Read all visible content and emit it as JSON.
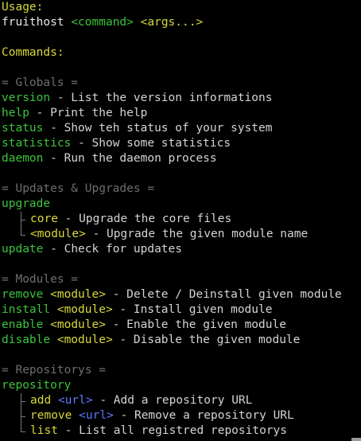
{
  "usage": {
    "label": "Usage:",
    "program": "fruithost",
    "command_arg": "<command>",
    "args_arg": "<args...>"
  },
  "commands_heading": "Commands:",
  "sections": {
    "globals": {
      "title": "= Globals =",
      "items": [
        {
          "cmd": "version",
          "desc": "- List the version informations"
        },
        {
          "cmd": "help",
          "desc": "- Print the help"
        },
        {
          "cmd": "status",
          "desc": "- Show teh status of your system"
        },
        {
          "cmd": "statistics",
          "desc": "- Show some statistics"
        },
        {
          "cmd": "daemon",
          "desc": "- Run the daemon process"
        }
      ]
    },
    "updates": {
      "title": "= Updates & Upgrades =",
      "upgrade": {
        "cmd": "upgrade",
        "subs": [
          {
            "cmd": "core",
            "desc": "- Upgrade the core files"
          },
          {
            "cmd": "<module>",
            "desc": "- Upgrade the given module name"
          }
        ]
      },
      "update": {
        "cmd": "update",
        "desc": "- Check for updates"
      }
    },
    "modules": {
      "title": "= Modules =",
      "items": [
        {
          "cmd": "remove",
          "arg": "<module>",
          "desc": "- Delete / Deinstall given module"
        },
        {
          "cmd": "install",
          "arg": "<module>",
          "desc": "- Install given module"
        },
        {
          "cmd": "enable",
          "arg": "<module>",
          "desc": "- Enable the given module"
        },
        {
          "cmd": "disable",
          "arg": "<module>",
          "desc": "- Disable the given module"
        }
      ]
    },
    "repositorys": {
      "title": "= Repositorys =",
      "cmd": "repository",
      "subs": [
        {
          "cmd": "add",
          "arg": "<url>",
          "desc": "- Add a repository URL"
        },
        {
          "cmd": "remove",
          "arg": "<url>",
          "desc": "- Remove a repository URL"
        },
        {
          "cmd": "list",
          "desc": "- List all registred repositorys"
        }
      ]
    }
  },
  "colors": {
    "background": "#000000",
    "heading_yellow": "#d8d83c",
    "command_green": "#3cc43c",
    "url_blue": "#5c78ff",
    "section_gray": "#6e6e6e",
    "text": "#d4d4d4"
  }
}
